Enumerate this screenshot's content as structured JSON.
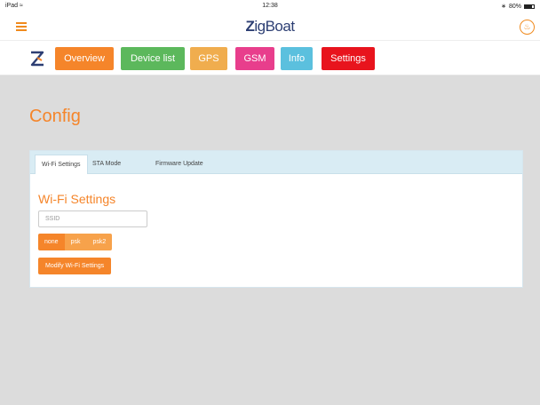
{
  "status_bar": {
    "device": "iPad",
    "time": "12:38",
    "battery": "80%"
  },
  "app": {
    "brand_z": "Z",
    "brand_rest": "igBoat"
  },
  "nav": {
    "buttons": [
      {
        "label": "Overview",
        "color": "#f5852a"
      },
      {
        "label": "Device list",
        "color": "#5cb85c"
      },
      {
        "label": "GPS",
        "color": "#f0ad4e"
      },
      {
        "label": "GSM",
        "color": "#e83e8c"
      },
      {
        "label": "Info",
        "color": "#5bc0de"
      },
      {
        "label": "Settings",
        "color": "#e8141d"
      }
    ]
  },
  "page": {
    "title": "Config"
  },
  "tabs": [
    {
      "label": "Wi-Fi Settings",
      "active": true
    },
    {
      "label": "STA Mode",
      "active": false
    },
    {
      "label": "Firmware Update",
      "active": false
    }
  ],
  "wifi": {
    "title": "Wi-Fi Settings",
    "ssid_placeholder": "SSID",
    "security_options": [
      "none",
      "psk",
      "psk2"
    ],
    "selected_security": "none",
    "modify_label": "Modify Wi-Fi Settings"
  },
  "colors": {
    "accent": "#f5852a",
    "brand": "#2c3e73",
    "background": "#dcdcdc"
  }
}
